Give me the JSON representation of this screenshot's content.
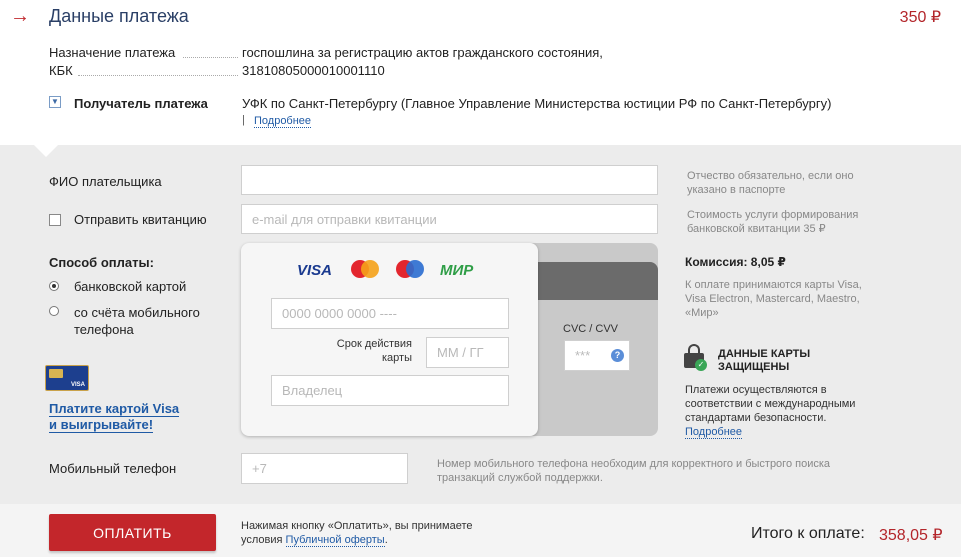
{
  "header": {
    "title": "Данные платежа",
    "amount": "350 ₽"
  },
  "payment": {
    "purpose_label": "Назначение платежа",
    "purpose_value": "госпошлина за регистрацию актов гражданского состояния,",
    "kbk_label": "КБК",
    "kbk_value": "31810805000010001110",
    "recipient_label": "Получатель платежа",
    "recipient_value": "УФК по Санкт-Петербургу (Главное Управление Министерства юстиции РФ по Санкт-Петербургу)",
    "more_link": "Подробнее"
  },
  "form": {
    "fio_label": "ФИО плательщика",
    "fio_hint": "Отчество обязательно, если оно указано в паспорте",
    "receipt_label": "Отправить квитанцию",
    "email_placeholder": "e-mail для отправки квитанции",
    "receipt_hint": "Стоимость услуги формирования банковской квитанции 35 ₽",
    "method_title": "Способ оплаты:",
    "method_card": "банковской картой",
    "method_mobile": "со счёта мобильного телефона",
    "visa_promo": "Платите картой Visa и выигрывайте!",
    "visa_promo_line1": "Платите картой Visa",
    "visa_promo_line2": "и выигрывайте!",
    "phone_label": "Мобильный телефон",
    "phone_placeholder": "+7",
    "phone_hint": "Номер мобильного телефона необходим для корректного и быстрого поиска транзакций службой поддержки."
  },
  "card": {
    "brands": [
      "VISA",
      "mastercard",
      "maestro",
      "МИР"
    ],
    "number_placeholder": "0000 0000 0000 ----",
    "expiry_label": "Срок действия карты",
    "expiry_placeholder": "ММ / ГГ",
    "owner_placeholder": "Владелец",
    "cvc_label": "CVC / CVV",
    "cvc_placeholder": "***",
    "help_icon_text": "?"
  },
  "side": {
    "commission": "Комиссия: 8,05 ₽",
    "accepted": "К оплате принимаются карты Visa, Visa Electron, Mastercard, Maestro, «Мир»",
    "secure_title": "ДАННЫЕ КАРТЫ ЗАЩИЩЕНЫ",
    "secure_text": "Платежи осуществляются в соответствии с международными стандартами безопасности.",
    "secure_link": "Подробнее"
  },
  "footer": {
    "pay_button": "ОПЛАТИТЬ",
    "note": "Нажимая кнопку «Оплатить», вы принимаете условия",
    "offer_link": "Публичной оферты",
    "total_label": "Итого к оплате:",
    "total_value": "358,05 ₽"
  }
}
